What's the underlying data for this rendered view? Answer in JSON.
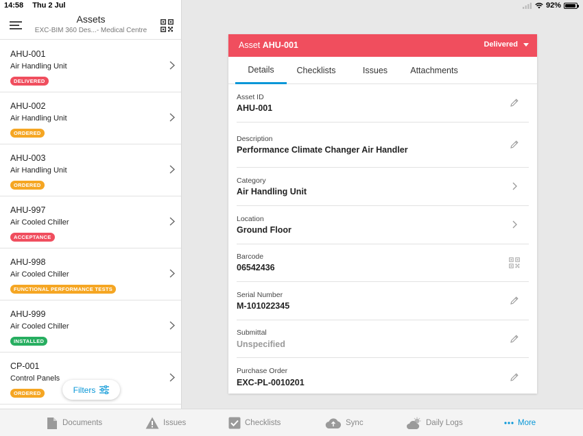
{
  "status_bar": {
    "time": "14:58",
    "date": "Thu 2 Jul",
    "battery": "92%",
    "battery_level": 0.92
  },
  "sidebar": {
    "title": "Assets",
    "subtitle": "EXC-BIM 360 Des...- Medical Centre",
    "filters_label": "Filters",
    "assets": [
      {
        "id": "AHU-001",
        "category": "Air Handling Unit",
        "status": "DELIVERED",
        "status_color": "#f04e5e"
      },
      {
        "id": "AHU-002",
        "category": "Air Handling Unit",
        "status": "ORDERED",
        "status_color": "#f5a623"
      },
      {
        "id": "AHU-003",
        "category": "Air Handling Unit",
        "status": "ORDERED",
        "status_color": "#f5a623"
      },
      {
        "id": "AHU-997",
        "category": "Air Cooled Chiller",
        "status": "ACCEPTANCE",
        "status_color": "#f04e5e"
      },
      {
        "id": "AHU-998",
        "category": "Air Cooled Chiller",
        "status": "FUNCTIONAL PERFORMANCE TESTS",
        "status_color": "#f5a623"
      },
      {
        "id": "AHU-999",
        "category": "Air Cooled Chiller",
        "status": "INSTALLED",
        "status_color": "#27ae60"
      },
      {
        "id": "CP-001",
        "category": "Control Panels",
        "status": "ORDERED",
        "status_color": "#f5a623"
      }
    ]
  },
  "detail": {
    "header_prefix": "Asset",
    "header_id": "AHU-001",
    "status": "Delivered",
    "header_color": "#f04e5e",
    "tabs": [
      "Details",
      "Checklists",
      "Issues",
      "Attachments"
    ],
    "fields": [
      {
        "label": "Asset ID",
        "value": "AHU-001",
        "icon": "pencil-icon"
      },
      {
        "label": "Description",
        "value": "Performance Climate Changer Air Handler",
        "icon": "pencil-icon"
      },
      {
        "label": "Category",
        "value": "Air Handling Unit",
        "icon": "chevron-right-icon"
      },
      {
        "label": "Location",
        "value": "Ground Floor",
        "icon": "chevron-right-icon"
      },
      {
        "label": "Barcode",
        "value": "06542436",
        "icon": "qr-code-icon"
      },
      {
        "label": "Serial Number",
        "value": "M-101022345",
        "icon": "pencil-icon"
      },
      {
        "label": "Submittal",
        "value": "Unspecified",
        "icon": "pencil-icon"
      },
      {
        "label": "Purchase Order",
        "value": "EXC-PL-0010201",
        "icon": "pencil-icon"
      }
    ]
  },
  "tabbar": {
    "items": [
      {
        "label": "Documents",
        "icon": "document-icon"
      },
      {
        "label": "Issues",
        "icon": "warning-icon"
      },
      {
        "label": "Checklists",
        "icon": "checklist-icon"
      },
      {
        "label": "Sync",
        "icon": "cloud-sync-icon"
      },
      {
        "label": "Daily Logs",
        "icon": "weather-icon"
      },
      {
        "label": "More",
        "icon": "more-dots-icon"
      }
    ],
    "active_color": "#0696d7"
  }
}
